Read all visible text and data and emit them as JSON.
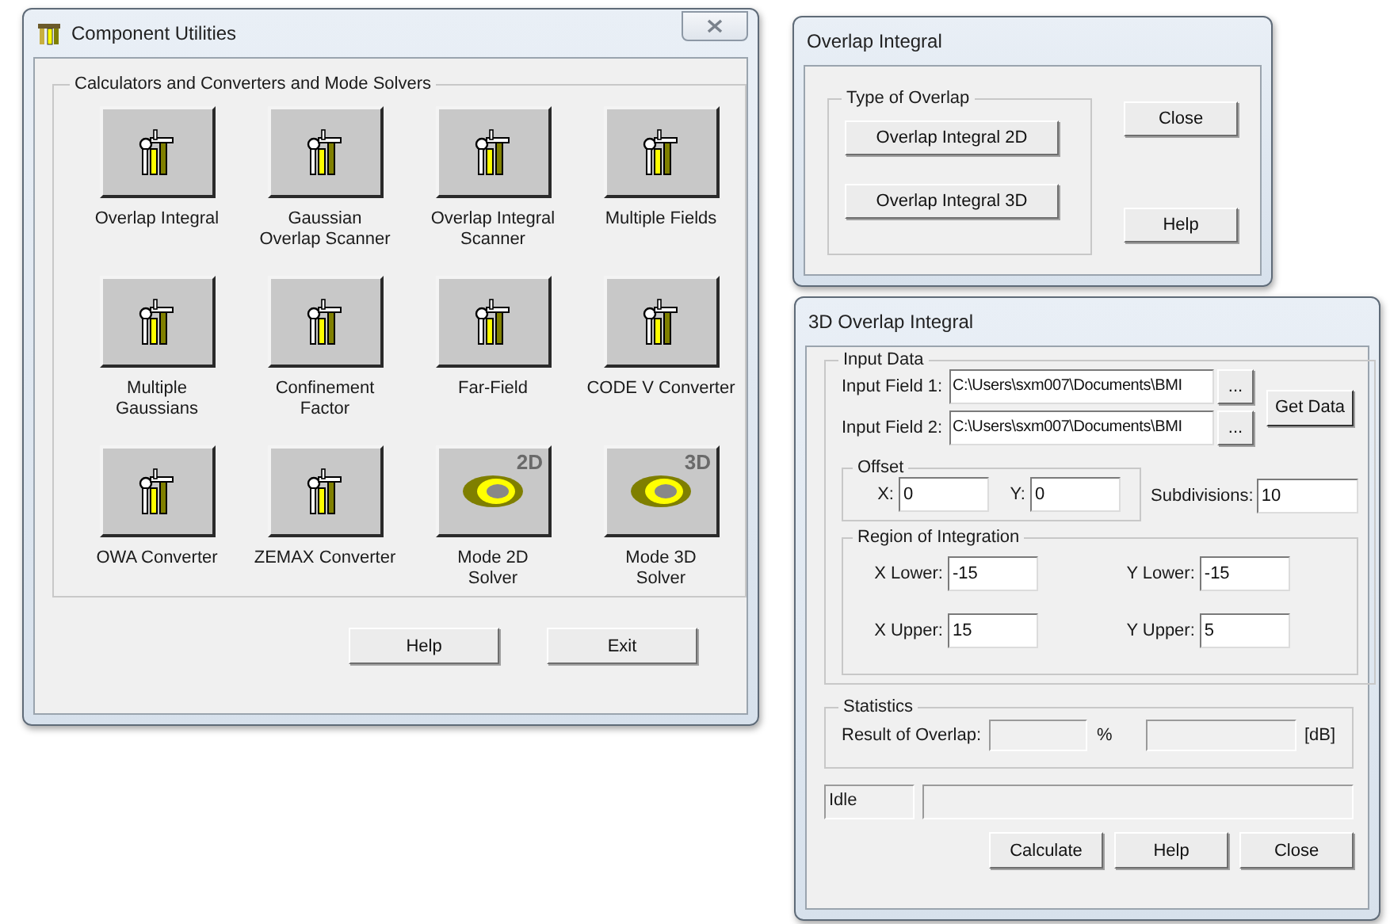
{
  "main_window": {
    "title": "Component Utilities",
    "group_label": "Calculators and Converters and Mode Solvers",
    "tools": [
      {
        "label": "Overlap Integral",
        "kind": "tools"
      },
      {
        "label": "Gaussian\nOverlap Scanner",
        "kind": "tools"
      },
      {
        "label": "Overlap Integral\nScanner",
        "kind": "tools"
      },
      {
        "label": "Multiple Fields",
        "kind": "tools"
      },
      {
        "label": "Multiple\nGaussians",
        "kind": "tools"
      },
      {
        "label": "Confinement\nFactor",
        "kind": "tools"
      },
      {
        "label": "Far-Field",
        "kind": "tools"
      },
      {
        "label": "CODE V Converter",
        "kind": "tools"
      },
      {
        "label": "OWA Converter",
        "kind": "tools"
      },
      {
        "label": "ZEMAX Converter",
        "kind": "tools"
      },
      {
        "label": "Mode 2D\nSolver",
        "kind": "mode",
        "badge": "2D"
      },
      {
        "label": "Mode 3D\nSolver",
        "kind": "mode",
        "badge": "3D"
      }
    ],
    "buttons": [
      "Help",
      "Exit"
    ]
  },
  "overlap_window": {
    "title": "Overlap Integral",
    "group_label": "Type of Overlap",
    "type_buttons": [
      "Overlap Integral 2D",
      "Overlap Integral 3D"
    ],
    "side_buttons": [
      "Close",
      "Help"
    ]
  },
  "overlap3d_window": {
    "title": "3D Overlap Integral",
    "input_group": "Input Data",
    "input_fields": [
      {
        "label": "Input Field 1:",
        "value": "C:\\Users\\sxm007\\Documents\\BMI",
        "browse": "..."
      },
      {
        "label": "Input Field 2:",
        "value": "C:\\Users\\sxm007\\Documents\\BMI",
        "browse": "..."
      }
    ],
    "get_data": "Get Data",
    "offset_group": "Offset",
    "offset": [
      {
        "label": "X:",
        "value": "0"
      },
      {
        "label": "Y:",
        "value": "0"
      }
    ],
    "subdivisions": {
      "label": "Subdivisions:",
      "value": "10"
    },
    "region_group": "Region of Integration",
    "region": [
      {
        "label": "X Lower:",
        "value": "-15"
      },
      {
        "label": "Y Lower:",
        "value": "-15"
      },
      {
        "label": "X Upper:",
        "value": "15"
      },
      {
        "label": "Y Upper:",
        "value": "5"
      }
    ],
    "statistics_group": "Statistics",
    "result_label": "Result of Overlap:",
    "percent_unit": "%",
    "db_unit": "[dB]",
    "status": "Idle",
    "buttons": [
      "Calculate",
      "Help",
      "Close"
    ]
  }
}
